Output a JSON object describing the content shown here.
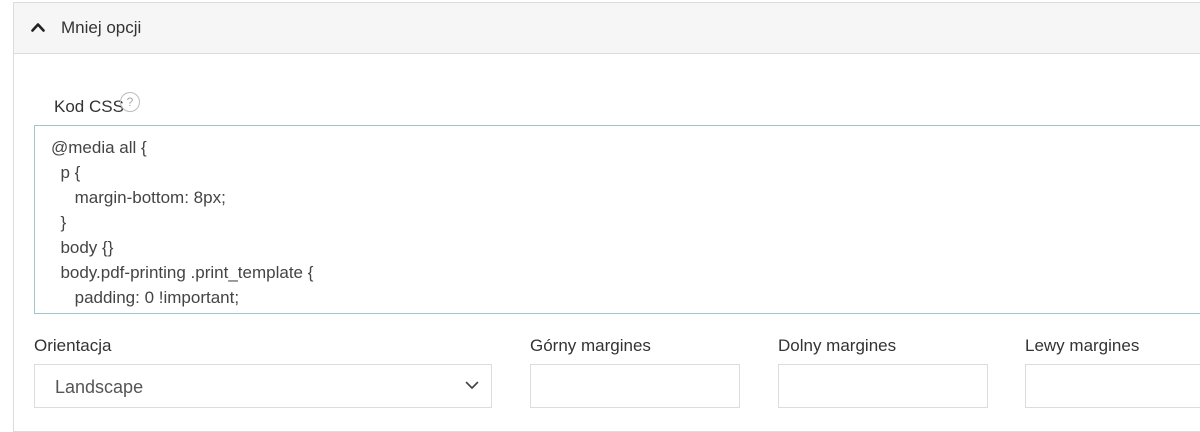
{
  "header": {
    "toggle_label": "Mniej opcji"
  },
  "css_section": {
    "label": "Kod CSS",
    "help_symbol": "?",
    "code_lines": [
      "@media all {",
      "  p {",
      "     margin-bottom: 8px;",
      "  }",
      "  body {}",
      "  body.pdf-printing .print_template {",
      "     padding: 0 !important;"
    ]
  },
  "fields": {
    "orientation": {
      "label": "Orientacja",
      "value": "Landscape"
    },
    "top_margin": {
      "label": "Górny margines",
      "value": ""
    },
    "bottom_margin": {
      "label": "Dolny margines",
      "value": ""
    },
    "left_margin": {
      "label": "Lewy margines",
      "value": ""
    }
  },
  "icons": {
    "collapse": "chevron-up-icon",
    "help": "help-icon",
    "dropdown": "chevron-down-icon"
  },
  "colors": {
    "header_bg": "#f6f6f6",
    "code_border": "#9ec6cc",
    "field_border": "#dcdcdc"
  }
}
